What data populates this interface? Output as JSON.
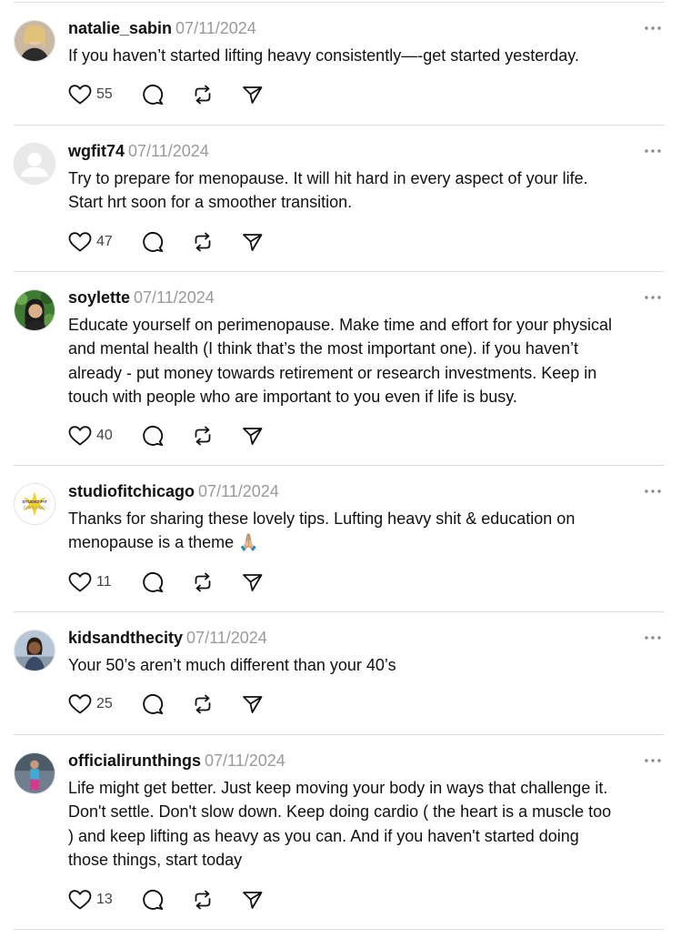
{
  "posts": [
    {
      "username": "natalie_sabin",
      "date": "07/11/2024",
      "lines": [
        "If you haven’t started lifting heavy consistently—-get started yesterday."
      ],
      "likes": "55"
    },
    {
      "username": "wgfit74",
      "date": "07/11/2024",
      "lines": [
        "Try to prepare for menopause. It will hit hard in every aspect of your life.",
        "Start hrt soon for a smoother transition."
      ],
      "likes": "47"
    },
    {
      "username": "soylette",
      "date": "07/11/2024",
      "lines": [
        "Educate yourself on perimenopause. Make time and effort for your physical",
        "and mental health (I think that’s the most important one). if you haven’t",
        "already - put money towards retirement or research investments. Keep in",
        "touch with people who are important to you even if life is busy."
      ],
      "likes": "40"
    },
    {
      "username": "studiofitchicago",
      "date": "07/11/2024",
      "lines": [
        "Thanks for sharing these lovely tips. Lufting heavy shit & education on",
        "menopause is a theme 🙏🏼"
      ],
      "likes": "11"
    },
    {
      "username": "kidsandthecity",
      "date": "07/11/2024",
      "lines": [
        "Your 50’s aren’t much different than your 40’s"
      ],
      "likes": "25"
    },
    {
      "username": "officialirunthings",
      "date": "07/11/2024",
      "lines": [
        "Life might get better. Just keep moving your body in ways that challenge it.",
        "Don't settle. Don't slow down. Keep doing cardio ( the heart is a muscle too",
        ") and keep lifting as heavy as you can. And if you haven't started doing",
        "those things, start today"
      ],
      "likes": "13"
    }
  ],
  "studio_logo": {
    "top": "STUDIO FIT",
    "bottom": "CHICAGO"
  },
  "icons": [
    "more-icon",
    "heart-icon",
    "comment-icon",
    "repost-icon",
    "share-icon"
  ]
}
